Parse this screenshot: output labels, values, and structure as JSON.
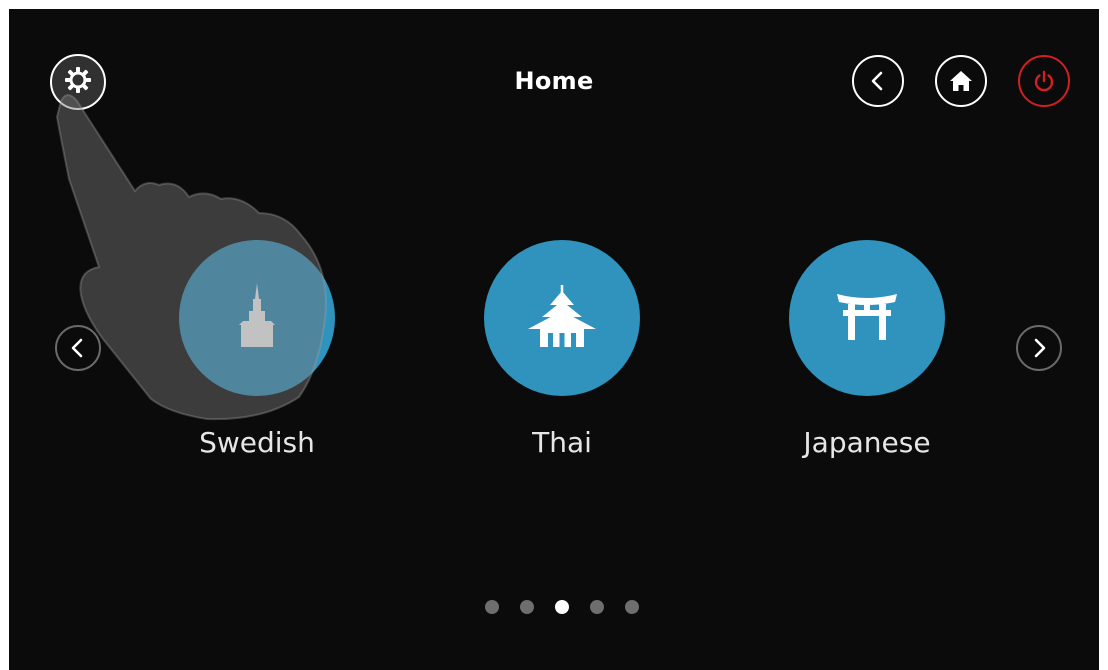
{
  "header": {
    "title": "Home"
  },
  "icons": {
    "settings": "gear-icon",
    "back": "chevron-left-icon",
    "home": "home-icon",
    "power": "power-icon",
    "prev": "chevron-left-icon",
    "next": "chevron-right-icon"
  },
  "colors": {
    "background": "#0b0b0b",
    "accent": "#2f93bd",
    "power": "#d02020",
    "dot_inactive": "#6e6e6e",
    "dot_active": "#ffffff"
  },
  "carousel": {
    "items": [
      {
        "label": "Swedish",
        "icon": "swedish-church-icon"
      },
      {
        "label": "Thai",
        "icon": "thai-temple-icon"
      },
      {
        "label": "Japanese",
        "icon": "torii-gate-icon"
      }
    ],
    "page_count": 5,
    "active_page": 3
  }
}
